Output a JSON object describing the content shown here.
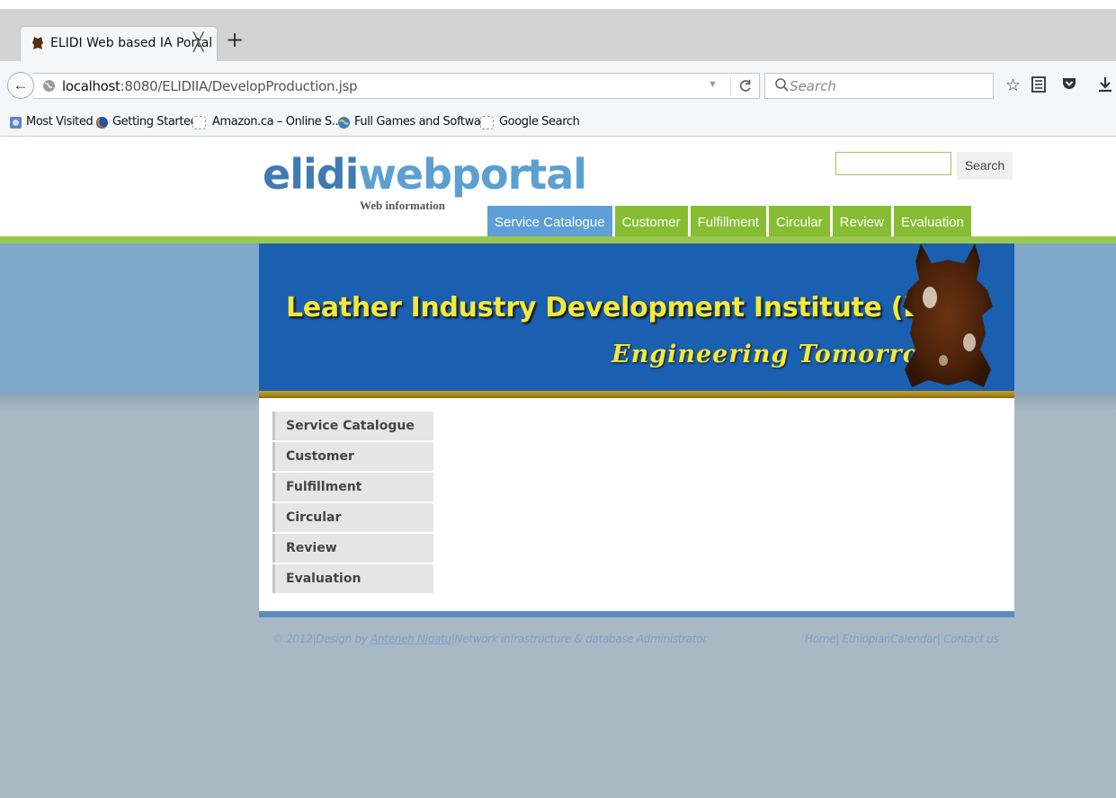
{
  "browser": {
    "tab": {
      "title": "ELIDI Web based IA Portal",
      "close_glyph": "╳",
      "favicon": "hide-favicon-icon"
    },
    "new_tab_glyph": "+",
    "back_glyph": "←",
    "url": {
      "host": "localhost",
      "rest": ":8080/ELIDIIA/DevelopProduction.jsp"
    },
    "reload_glyph": "C",
    "dropdown_glyph": "▼",
    "search_placeholder": "Search",
    "toolbar_glyphs": {
      "bookmark_star": "☆",
      "reading_list": "☰",
      "pocket": "▼",
      "download": "⤓"
    },
    "bookmarks": [
      {
        "label": "Most Visited",
        "icon": "most-visited-icon"
      },
      {
        "label": "Getting Started",
        "icon": "firefox-icon"
      },
      {
        "label": "Amazon.ca – Online S...",
        "icon": "blank-page-icon"
      },
      {
        "label": "Full Games and Softwa...",
        "icon": "globe-icon"
      },
      {
        "label": "Google Search",
        "icon": "blank-page-icon"
      }
    ]
  },
  "site": {
    "logo": {
      "part1": "elidi",
      "part2": "webportal",
      "subtitle": "Web information"
    },
    "search_button": "Search",
    "topnav": [
      "Service Catalogue",
      "Customer",
      "Fulfillment",
      "Circular",
      "Review",
      "Evaluation"
    ],
    "banner": {
      "title": "Leather Industry Development Institute (LIDI)",
      "tagline": "Engineering Tomorrow"
    },
    "sidemenu": [
      "Service Catalogue",
      "Customer",
      "Fulfillment",
      "Circular",
      "Review",
      "Evaluation"
    ],
    "footer": {
      "prefix": "© 2012|Design by ",
      "author": "Anteneh Nigatu",
      "suffix": "|Network infrastructure & database Administrator",
      "links": "Home| EthiopianCalendar| Contact us"
    }
  },
  "colors": {
    "nav_green": "#86bd33",
    "nav_active_blue": "#5d9fd6",
    "banner_blue": "#1a5fb0",
    "banner_text_yellow": "#f3e93a",
    "page_background": "#a8b9c3"
  }
}
